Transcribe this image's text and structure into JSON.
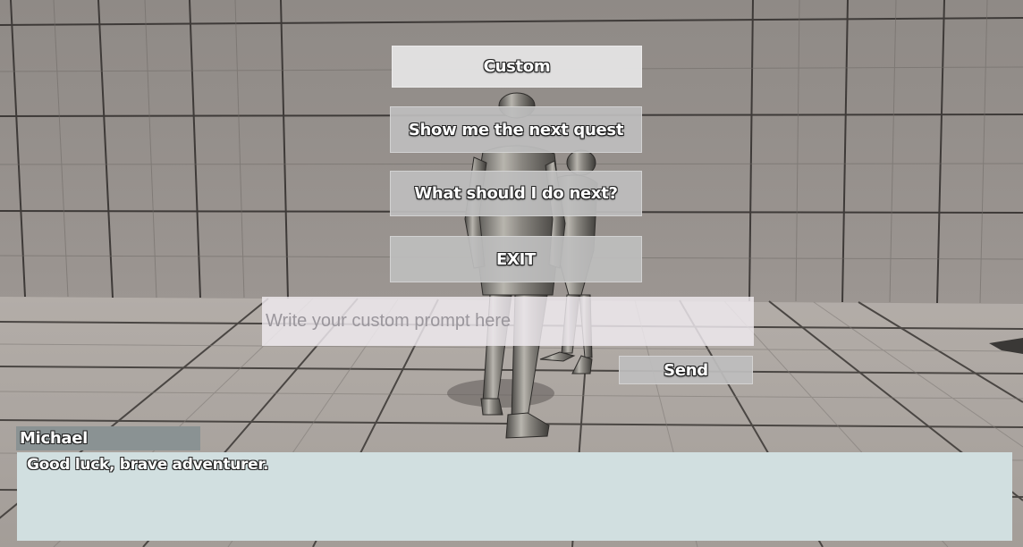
{
  "menu": {
    "custom_label": "Custom",
    "quest_label": "Show me the next quest",
    "next_label": "What should I do next?",
    "exit_label": "EXIT"
  },
  "prompt": {
    "placeholder": "Write your custom prompt here",
    "value": "",
    "send_label": "Send"
  },
  "dialogue": {
    "speaker": "Michael",
    "text": "Good luck, brave adventurer."
  },
  "colors": {
    "wall": "#8c8783",
    "floor": "#a9a39e",
    "grid_line": "#3e3a38",
    "dialogue_bg": "#d1dfe0",
    "speaker_bg": "#8a9293"
  },
  "icons": {
    "characters": "mannequin-figure"
  }
}
